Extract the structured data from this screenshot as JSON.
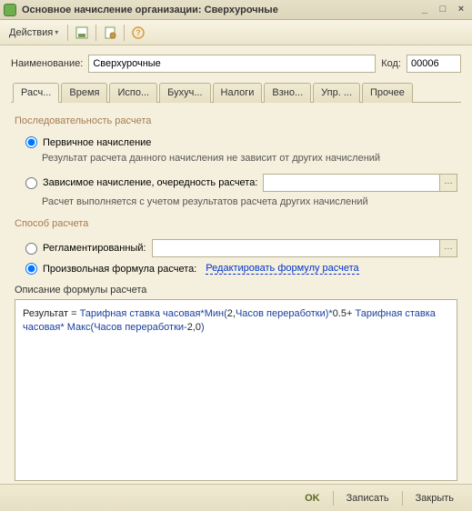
{
  "window": {
    "title": "Основное начисление организации: Сверхурочные"
  },
  "toolbar": {
    "actions_label": "Действия"
  },
  "fields": {
    "name_label": "Наименование:",
    "name_value": "Сверхурочные",
    "code_label": "Код:",
    "code_value": "00006"
  },
  "tabs": [
    "Расч...",
    "Время",
    "Испо...",
    "Бухуч...",
    "Налоги",
    "Взно...",
    "Упр. ...",
    "Прочее"
  ],
  "calc": {
    "seq_title": "Последовательность расчета",
    "primary_label": "Первичное начисление",
    "primary_hint": "Результат расчета данного начисления не зависит от других начислений",
    "dependent_label": "Зависимое начисление, очередность расчета:",
    "dependent_hint": "Расчет выполняется с учетом результатов расчета других начислений",
    "method_title": "Способ расчета",
    "reg_label": "Регламентированный:",
    "custom_label": "Произвольная формула расчета:",
    "edit_formula_link": "Редактировать формулу расчета",
    "desc_title": "Описание формулы расчета",
    "formula": {
      "p1": "Результат = ",
      "p2": "Тарифная ставка часовая*Мин(",
      "p3": "2,",
      "p4": "Часов переработки)*",
      "p5": "0.5+ ",
      "p6": "Тарифная ставка часовая* Макс(Часов переработки-",
      "p7": "2,0",
      "p8": ")"
    }
  },
  "footer": {
    "ok": "OK",
    "save": "Записать",
    "close": "Закрыть"
  }
}
